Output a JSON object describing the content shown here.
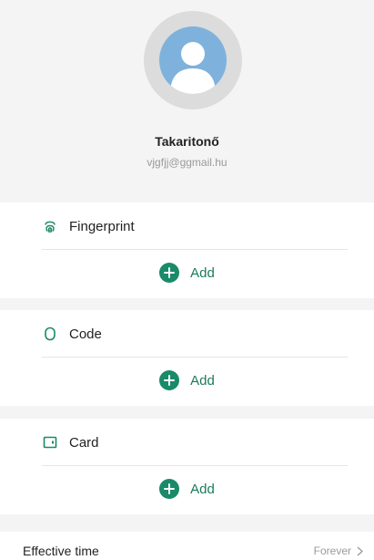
{
  "profile": {
    "name": "Takaritonő",
    "email": "vjgfjj@ggmail.hu",
    "avatar_icon": "user-avatar-icon"
  },
  "sections": [
    {
      "title": "Fingerprint",
      "icon": "fingerprint-icon",
      "add_label": "Add"
    },
    {
      "title": "Code",
      "icon": "code-icon",
      "add_label": "Add"
    },
    {
      "title": "Card",
      "icon": "card-icon",
      "add_label": "Add"
    }
  ],
  "effective_time": {
    "label": "Effective time",
    "value": "Forever"
  },
  "colors": {
    "accent": "#1a8a69",
    "background": "#f4f4f4",
    "avatar": "#7eb2dc"
  }
}
